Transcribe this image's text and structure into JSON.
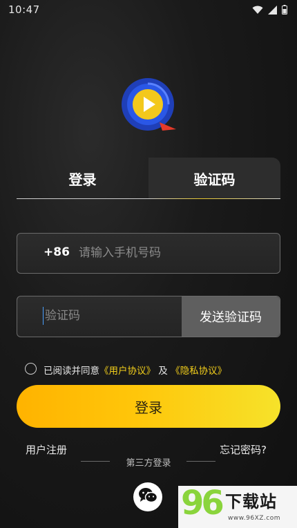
{
  "status_bar": {
    "time": "10:47"
  },
  "tabs": {
    "login": "登录",
    "verification": "验证码"
  },
  "phone": {
    "prefix": "+86",
    "placeholder": "请输入手机号码"
  },
  "code": {
    "placeholder": "验证码",
    "send_button": "发送验证码"
  },
  "agreement": {
    "prefix": "已阅读并同意",
    "user_agreement": "《用户协议》",
    "and": "及",
    "privacy_agreement": "《隐私协议》"
  },
  "login_button": "登录",
  "register": "用户注册",
  "forgot_password": "忘记密码?",
  "third_party_label": "第三方登录",
  "watermark": {
    "logo_text": "96",
    "title": "下载站",
    "url": "www.96XZ.com"
  },
  "colors": {
    "accent": "#f3cf1b",
    "button_start": "#ffb300",
    "button_end": "#f6e22a"
  }
}
